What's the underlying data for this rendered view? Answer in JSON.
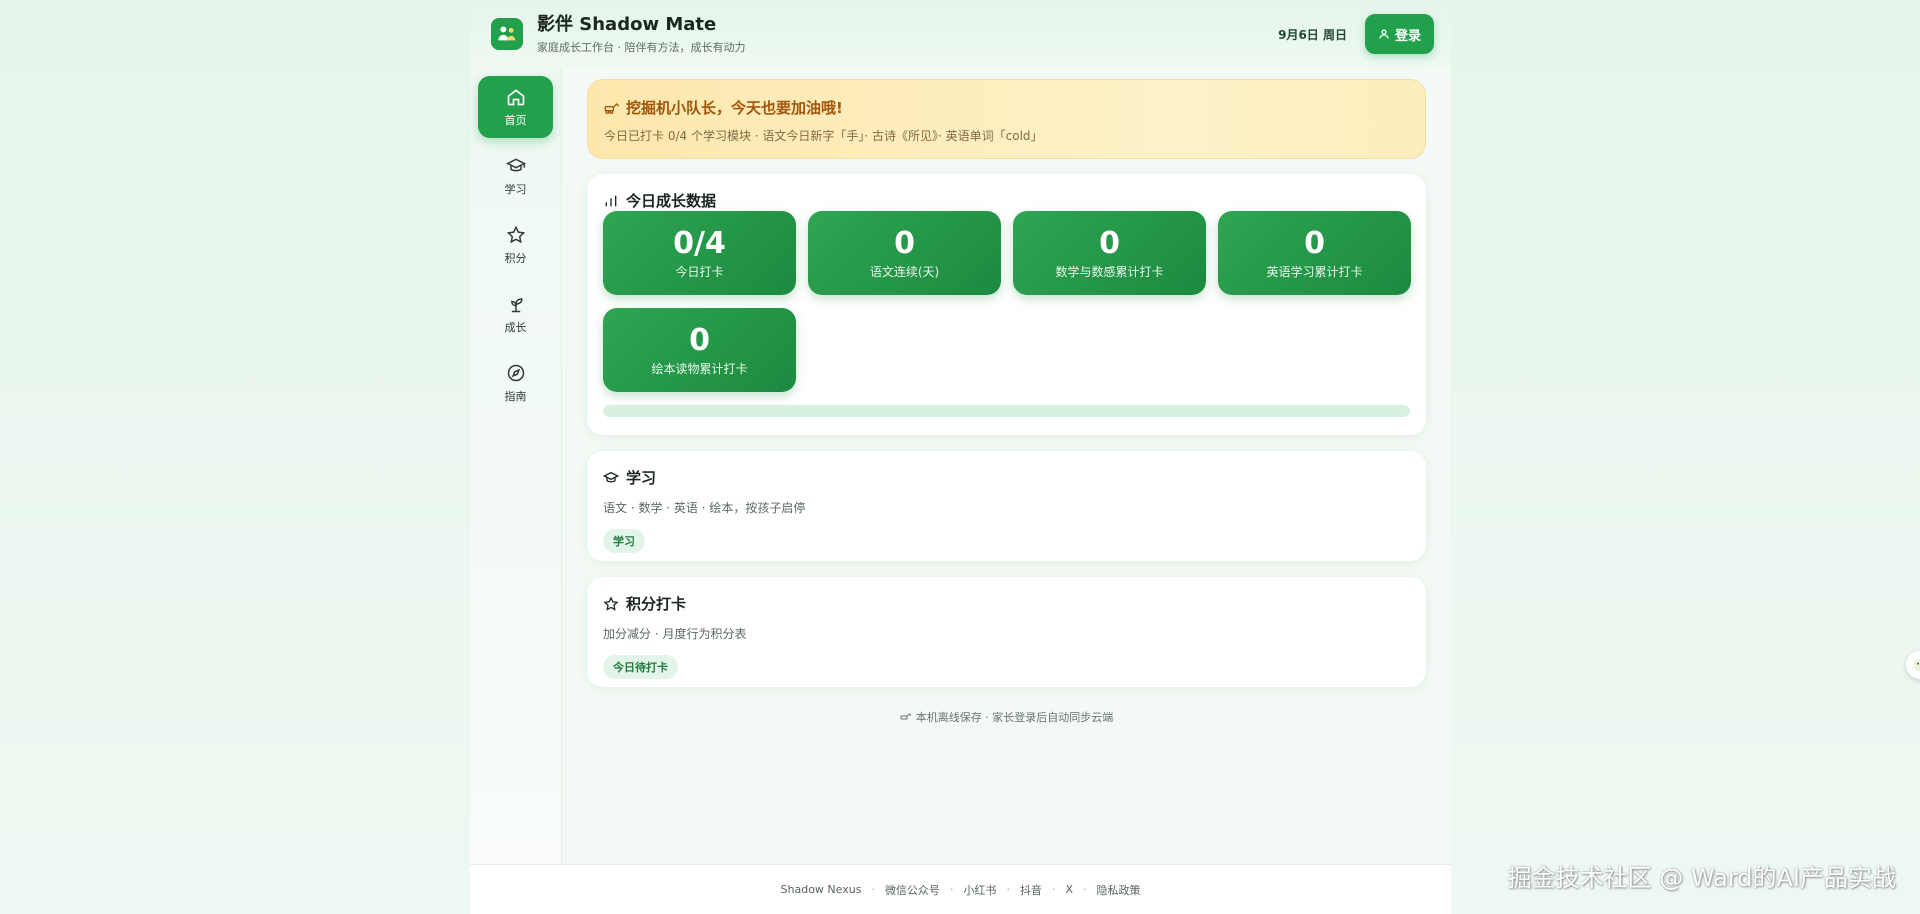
{
  "header": {
    "title": "影伴 Shadow Mate",
    "subtitle": "家庭成长工作台 · 陪伴有方法，成长有动力",
    "date": "9月6日 周日",
    "login_label": "登录"
  },
  "sidebar": {
    "items": [
      {
        "label": "首页",
        "icon": "home-icon",
        "active": true
      },
      {
        "label": "学习",
        "icon": "graduation-cap-icon",
        "active": false
      },
      {
        "label": "积分",
        "icon": "star-icon",
        "active": false
      },
      {
        "label": "成长",
        "icon": "sprout-icon",
        "active": false
      },
      {
        "label": "指南",
        "icon": "compass-icon",
        "active": false
      }
    ]
  },
  "banner": {
    "title": "挖掘机小队长，今天也要加油哦!",
    "subtitle": "今日已打卡 0/4 个学习模块 · 语文今日新字「手」· 古诗《所见》· 英语单词「cold」"
  },
  "stats_card": {
    "title": "今日成长数据",
    "stats": [
      {
        "value": "0/4",
        "label": "今日打卡"
      },
      {
        "value": "0",
        "label": "语文连续(天)"
      },
      {
        "value": "0",
        "label": "数学与数感累计打卡"
      },
      {
        "value": "0",
        "label": "英语学习累计打卡"
      },
      {
        "value": "0",
        "label": "绘本读物累计打卡"
      }
    ],
    "progress": 0
  },
  "study_card": {
    "title": "学习",
    "desc": "语文 · 数学 · 英语 · 绘本，按孩子启停",
    "tag": "学习"
  },
  "points_card": {
    "title": "积分打卡",
    "desc": "加分减分 · 月度行为积分表",
    "tag": "今日待打卡"
  },
  "local_note": "本机离线保存 · 家长登录后自动同步云端",
  "footer": {
    "links": [
      "Shadow Nexus",
      "微信公众号",
      "小红书",
      "抖音",
      "X",
      "隐私政策"
    ]
  },
  "watermark": "掘金技术社区 @ Ward的AI产品实战",
  "colors": {
    "brand": "#22a04b",
    "banner_text": "#a0560c",
    "tag_bg": "#e3f5e9"
  }
}
